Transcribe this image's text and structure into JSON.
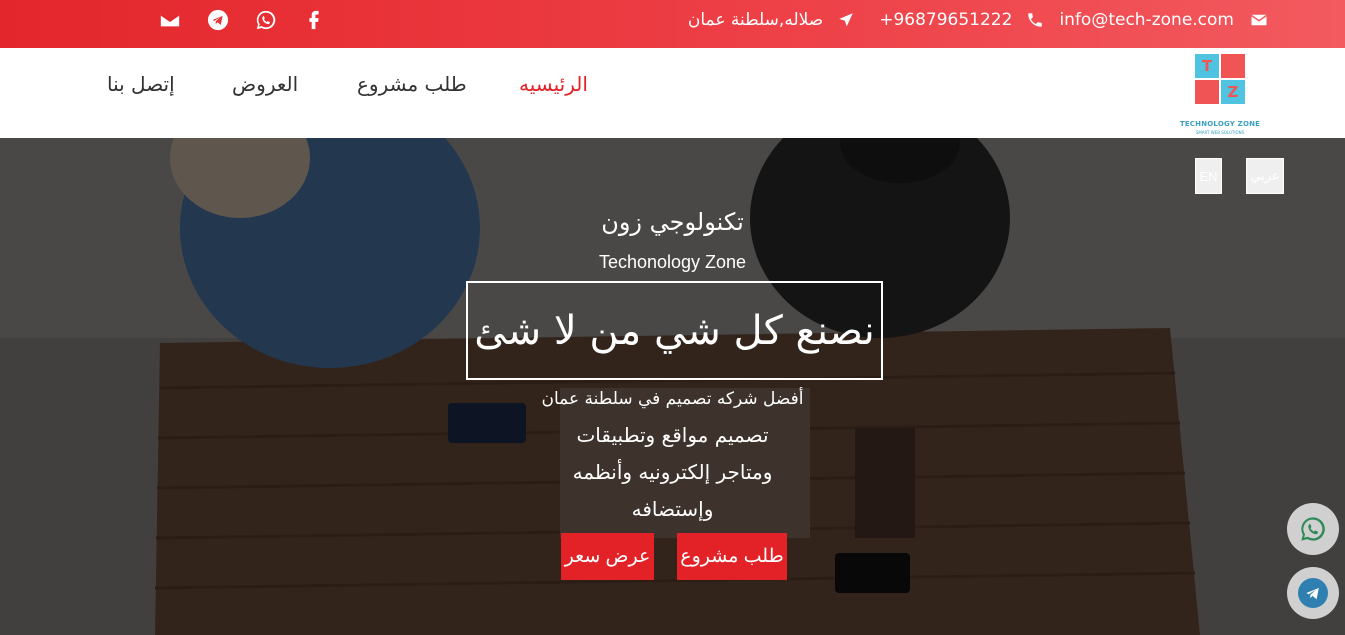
{
  "topbar": {
    "email": "info@tech-zone.com",
    "phone": "+96879651222",
    "location": "صلاله,سلطنة عمان",
    "social": [
      "email-icon",
      "telegram-icon",
      "whatsapp-icon",
      "facebook-icon"
    ]
  },
  "logo": {
    "letter_t": "T",
    "letter_z": "Z",
    "caption": "TECHNOLOGY ZONE",
    "tagline": "SMART WEB SOLUTIONS"
  },
  "nav": {
    "home": "الرئيسيه",
    "request": "طلب مشروع",
    "offers": "العروض",
    "contact": "إتصل بنا"
  },
  "hero": {
    "lang_ar": "عربي",
    "lang_en": "EN",
    "title_ar": "تكنولوجي زون",
    "title_en": "Techonology Zone",
    "slogan": "نصنع كل شي من لا شئ",
    "subtitle": "أفضل شركه تصميم في سلطنة عمان",
    "line1": "تصميم مواقع وتطبيقات",
    "line2": "ومتاجر إلكترونيه وأنظمه",
    "line3": "وإستضافه",
    "btn_request": "طلب مشروع",
    "btn_quote": "عرض سعر"
  },
  "colors": {
    "accent": "#e32227",
    "logo_red": "#f05454",
    "logo_blue": "#4fc3e0"
  }
}
